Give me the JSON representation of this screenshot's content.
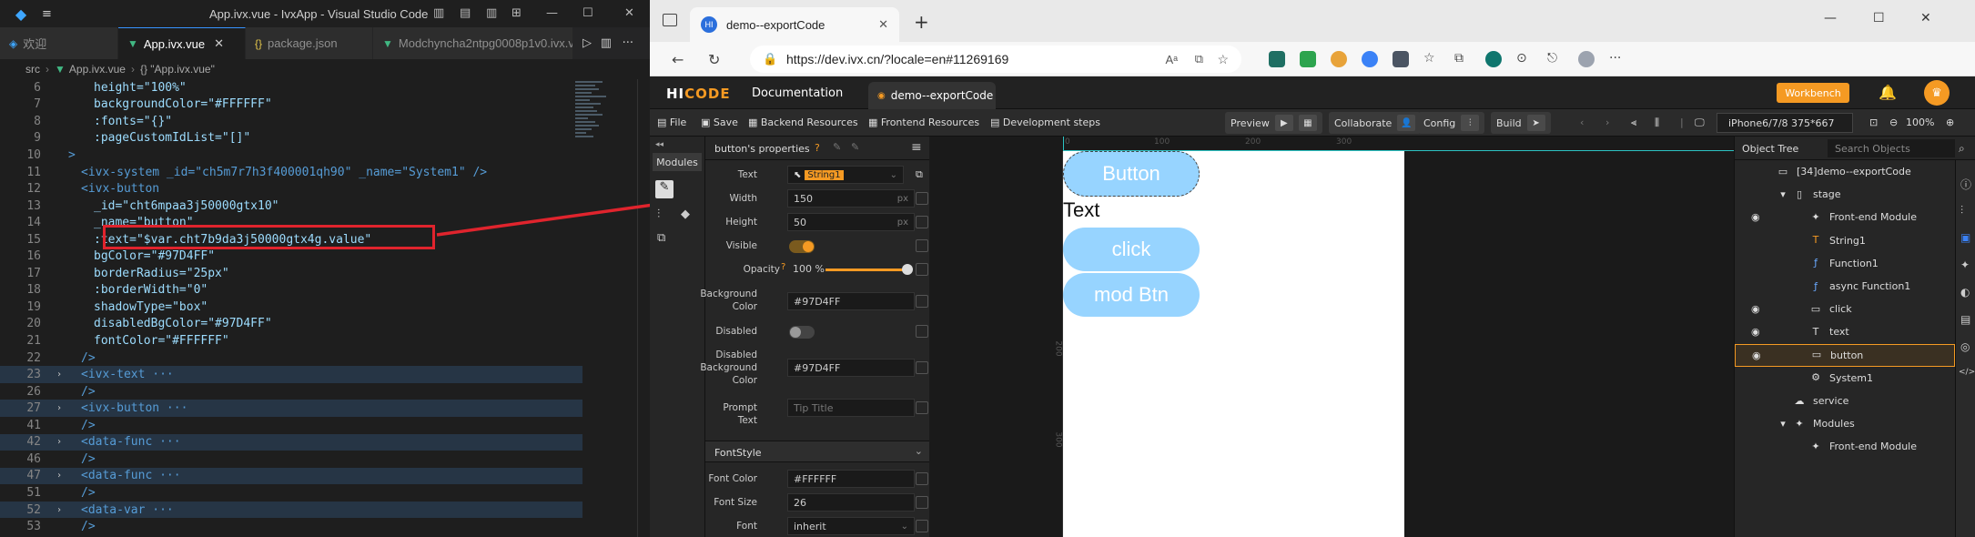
{
  "vscode": {
    "window_title": "App.ivx.vue - IvxApp - Visual Studio Code",
    "tabs": [
      {
        "label": "欢迎",
        "icon": "vscode-icon"
      },
      {
        "label": "App.ivx.vue",
        "icon": "vue-icon",
        "active": true
      },
      {
        "label": "package.json",
        "icon": "braces-icon"
      },
      {
        "label": "Modchynchа2ntpg0008p1v0.ivx.vu",
        "icon": "vue-icon"
      }
    ],
    "breadcrumb": {
      "root": "src",
      "file": "App.ivx.vue",
      "symbol": "{} \"App.ivx.vue\""
    },
    "lines": [
      {
        "n": "6",
        "text": "height=\"100%\""
      },
      {
        "n": "7",
        "text": "backgroundColor=\"#FFFFFF\""
      },
      {
        "n": "8",
        "text": ":fonts=\"{}\""
      },
      {
        "n": "9",
        "text": ":pageCustomIdList=\"[]\""
      },
      {
        "n": "10",
        "text": ">"
      },
      {
        "n": "11",
        "text": "<ivx-system _id=\"ch5m7r7h3f400001qh90\" _name=\"System1\" />"
      },
      {
        "n": "12",
        "text": "<ivx-button"
      },
      {
        "n": "13",
        "text": "_id=\"cht6mpaa3j50000gtx10\""
      },
      {
        "n": "14",
        "text": "_name=\"button\""
      },
      {
        "n": "15",
        "text": ":text=\"$var.cht7b9da3j50000gtx4g.value\""
      },
      {
        "n": "16",
        "text": "bgColor=\"#97D4FF\""
      },
      {
        "n": "17",
        "text": "borderRadius=\"25px\""
      },
      {
        "n": "18",
        "text": ":borderWidth=\"0\""
      },
      {
        "n": "19",
        "text": "shadowType=\"box\""
      },
      {
        "n": "20",
        "text": "disabledBgColor=\"#97D4FF\""
      },
      {
        "n": "21",
        "text": "fontColor=\"#FFFFFF\""
      },
      {
        "n": "22",
        "text": "/>"
      },
      {
        "n": "23",
        "text": "<ivx-text ···"
      },
      {
        "n": "26",
        "text": "/>"
      },
      {
        "n": "27",
        "text": "<ivx-button ···"
      },
      {
        "n": "41",
        "text": "/>"
      },
      {
        "n": "42",
        "text": "<data-func ···"
      },
      {
        "n": "46",
        "text": "/>"
      },
      {
        "n": "47",
        "text": "<data-func ···"
      },
      {
        "n": "51",
        "text": "/>"
      },
      {
        "n": "52",
        "text": "<data-var ···"
      },
      {
        "n": "53",
        "text": "/>"
      }
    ]
  },
  "browser": {
    "tab_title": "demo--exportCode",
    "tab_favicon": "HI",
    "url": "https://dev.ivx.cn/?locale=en#11269169"
  },
  "ivx": {
    "brand_a": "HI",
    "brand_b": "CODE",
    "doc_link": "Documentation",
    "project_tab": "demo--exportCode",
    "workbench": "Workbench",
    "toolbar": {
      "file": "File",
      "save": "Save",
      "backend": "Backend Resources",
      "frontend": "Frontend Resources",
      "dev_steps": "Development steps",
      "preview": "Preview",
      "collaborate": "Collaborate",
      "config": "Config",
      "build": "Build",
      "device": "iPhone6/7/8 375*667",
      "zoom": "100%"
    },
    "rail": {
      "modules": "Modules"
    },
    "props": {
      "title": "button's properties",
      "text_label": "Text",
      "text_value": "String1",
      "width_label": "Width",
      "width_value": "150",
      "width_unit": "px",
      "height_label": "Height",
      "height_value": "50",
      "height_unit": "px",
      "visible_label": "Visible",
      "opacity_label": "Opacity",
      "opacity_value": "100 %",
      "opacity_level": 1.0,
      "bg_label": "Background Color",
      "bg_value": "#97D4FF",
      "disabled_label": "Disabled",
      "disabled_bg_label": "Disabled Background Color",
      "disabled_bg_value": "#97D4FF",
      "prompt_label": "Prompt Text",
      "prompt_placeholder": "Tip Title",
      "fontstyle": "FontStyle",
      "font_color_label": "Font Color",
      "font_color_value": "#FFFFFF",
      "font_size_label": "Font Size",
      "font_size_value": "26",
      "font_label": "Font",
      "font_value": "inherit"
    },
    "canvas": {
      "ruler_ticks": [
        "0",
        "100",
        "200",
        "300"
      ],
      "button_label": "Button",
      "text_label": "Text",
      "click_label": "click",
      "mod_btn_label": "mod Btn"
    },
    "tree": {
      "title": "Object Tree",
      "search_placeholder": "Search Objects",
      "items": [
        {
          "label": "[34]demo--exportCode",
          "icon": "page-icon"
        },
        {
          "label": "stage",
          "icon": "phone-icon"
        },
        {
          "label": "Front-end Module",
          "icon": "puzzle-icon"
        },
        {
          "label": "String1",
          "icon": "string-var-icon"
        },
        {
          "label": "Function1",
          "icon": "function-icon"
        },
        {
          "label": "async Function1",
          "icon": "function-icon"
        },
        {
          "label": "click",
          "icon": "button-icon"
        },
        {
          "label": "text",
          "icon": "text-icon"
        },
        {
          "label": "button",
          "icon": "button-icon"
        },
        {
          "label": "System1",
          "icon": "gear-icon"
        },
        {
          "label": "service",
          "icon": "cloud-icon"
        },
        {
          "label": "Modules",
          "icon": "puzzle-icon"
        },
        {
          "label": "Front-end Module",
          "icon": "puzzle-icon"
        }
      ]
    }
  },
  "colors": {
    "accent": "#f59a23",
    "button_bg": "#97D4FF",
    "highlight": "#e0242d"
  }
}
